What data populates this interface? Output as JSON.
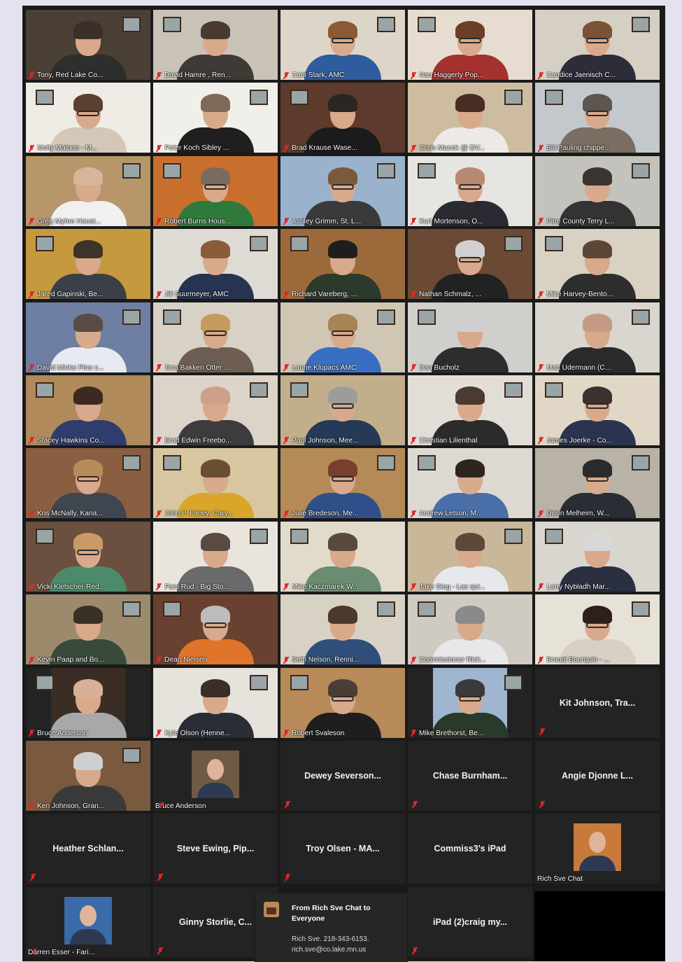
{
  "participants": [
    {
      "name": "Tony, Red Lake Co...",
      "muted": true,
      "video": true,
      "wall": "#4a4036",
      "hair": "#3a3029",
      "shirt": "#2e2e2e",
      "glasses": false
    },
    {
      "name": "David Hamre , Ren...",
      "muted": true,
      "video": true,
      "wall": "#c9c3b7",
      "hair": "#4a3a2e",
      "shirt": "#3e3a36",
      "glasses": false
    },
    {
      "name": "Carli Stark, AMC",
      "muted": true,
      "video": true,
      "wall": "#ddd6c8",
      "hair": "#8a5a34",
      "shirt": "#2f5c9e",
      "glasses": true
    },
    {
      "name": "Nan Haggerty Pop...",
      "muted": true,
      "video": true,
      "wall": "#e6ddd0",
      "hair": "#6b3e25",
      "shirt": "#a3312e",
      "glasses": true
    },
    {
      "name": "Candice Jaenisch C...",
      "muted": true,
      "video": true,
      "wall": "#d6cfc3",
      "hair": "#7a5236",
      "shirt": "#2d2d3a",
      "glasses": true
    },
    {
      "name": "Molly Malone - M...",
      "muted": true,
      "video": true,
      "wall": "#efece6",
      "hair": "#5b4030",
      "shirt": "#d2c7b8",
      "glasses": true
    },
    {
      "name": "Peter Koch Sibley ...",
      "muted": true,
      "video": true,
      "wall": "#f1efe9",
      "hair": "#7d6a58",
      "shirt": "#1f1f1f",
      "glasses": false
    },
    {
      "name": "Brad Krause Wase...",
      "muted": true,
      "video": true,
      "wall": "#5e3a2c",
      "hair": "#2c2622",
      "shirt": "#1b1b1b",
      "glasses": false
    },
    {
      "name": "Chris Macek @ DV...",
      "muted": true,
      "video": true,
      "wall": "#cdbca0",
      "hair": "#4a2d22",
      "shirt": "#ece9e6",
      "glasses": false
    },
    {
      "name": "Bill Pauling chippe...",
      "muted": true,
      "video": true,
      "wall": "#c3c8cc",
      "hair": "#5c5550",
      "shirt": "#7a6d62",
      "glasses": true
    },
    {
      "name": "Greg Myhre  Houst...",
      "muted": true,
      "video": true,
      "wall": "#b79669",
      "hair": "#d8b49a",
      "shirt": "#f0f0f0",
      "glasses": false
    },
    {
      "name": "Robert Burns Hous...",
      "muted": true,
      "video": true,
      "wall": "#c86f2e",
      "hair": "#7a6b60",
      "shirt": "#2d7a3b",
      "glasses": true
    },
    {
      "name": "Ashley Grimm, St. L...",
      "muted": true,
      "video": true,
      "wall": "#9ab2cc",
      "hair": "#7a5a3c",
      "shirt": "#3a3a3a",
      "glasses": true
    },
    {
      "name": "Kurt Mortenson, O...",
      "muted": true,
      "video": true,
      "wall": "#e7e5e1",
      "hair": "#b88a72",
      "shirt": "#2a2a33",
      "glasses": true
    },
    {
      "name": "Pine County Terry L...",
      "muted": true,
      "video": true,
      "wall": "#c4c2bc",
      "hair": "#3a3530",
      "shirt": "#333333",
      "glasses": false
    },
    {
      "name": "Jared Gapinski, Be...",
      "muted": true,
      "video": true,
      "wall": "#c59a3e",
      "hair": "#3e3329",
      "shirt": "#3b3f48",
      "glasses": false
    },
    {
      "name": "Jill Suurmeyer, AMC",
      "muted": true,
      "video": true,
      "wall": "#dedbd5",
      "hair": "#8a5c3a",
      "shirt": "#263352",
      "glasses": false
    },
    {
      "name": "Richard Vareberg, ...",
      "muted": true,
      "video": true,
      "wall": "#9c6a3a",
      "hair": "#1e1e1e",
      "shirt": "#2c3a2c",
      "glasses": false
    },
    {
      "name": "Nathan Schmalz, ...",
      "muted": true,
      "video": true,
      "wall": "#6a4a34",
      "hair": "#d0d0d0",
      "shirt": "#222222",
      "glasses": true
    },
    {
      "name": "Mike Harvey-Bento...",
      "muted": true,
      "video": true,
      "wall": "#d9d2c2",
      "hair": "#5c4636",
      "shirt": "#2e2e2e",
      "glasses": false
    },
    {
      "name": "David Minke Pine c...",
      "muted": true,
      "video": true,
      "wall": "#6e7fa3",
      "hair": "#5a4c44",
      "shirt": "#e7ebf1",
      "glasses": false
    },
    {
      "name": "Tara Bakken  Otter ...",
      "muted": true,
      "video": true,
      "wall": "#d8d2c6",
      "hair": "#c49a5e",
      "shirt": "#6e5e52",
      "glasses": true
    },
    {
      "name": "Laurie Klupacs  AMC",
      "muted": true,
      "video": true,
      "wall": "#cfc7b4",
      "hair": "#a88454",
      "shirt": "#3a6ec2",
      "glasses": true
    },
    {
      "name": "Dan   Bucholz",
      "muted": true,
      "video": true,
      "wall": "#cfd0cc",
      "hair": "#cfcfcf",
      "shirt": "#2d2d2d",
      "glasses": false
    },
    {
      "name": "Matt Udermann (C...",
      "muted": true,
      "video": true,
      "wall": "#d8d6cf",
      "hair": "#c49a84",
      "shirt": "#2a2a2a",
      "glasses": false
    },
    {
      "name": "Stacey Hawkins Co...",
      "muted": true,
      "video": true,
      "wall": "#b08a5a",
      "hair": "#3c2a22",
      "shirt": "#2f3c6e",
      "glasses": false
    },
    {
      "name": "Brad Edwin Freebo...",
      "muted": true,
      "video": true,
      "wall": "#dcd4c8",
      "hair": "#cfa088",
      "shirt": "#3c3c3c",
      "glasses": false
    },
    {
      "name": "Paul Johnson, Mee...",
      "muted": true,
      "video": true,
      "wall": "#c2ae8a",
      "hair": "#9c9c9c",
      "shirt": "#263a58",
      "glasses": true
    },
    {
      "name": "Christian Lilienthal",
      "muted": true,
      "video": true,
      "wall": "#e2ddd6",
      "hair": "#4a3a30",
      "shirt": "#2b2b2b",
      "glasses": false
    },
    {
      "name": "James Joerke - Co...",
      "muted": true,
      "video": true,
      "wall": "#e0d7c6",
      "hair": "#3a3230",
      "shirt": "#2a3450",
      "glasses": true
    },
    {
      "name": "Kris McNally, Kana...",
      "muted": true,
      "video": true,
      "wall": "#8a5e40",
      "hair": "#b88c5a",
      "shirt": "#3f4650",
      "glasses": true
    },
    {
      "name": "John P. Fahey, Cary...",
      "muted": true,
      "video": true,
      "wall": "#d8c6a0",
      "hair": "#6a4e34",
      "shirt": "#d9a62a",
      "glasses": false
    },
    {
      "name": "Julie Bredeson, Me...",
      "muted": true,
      "video": true,
      "wall": "#b48a56",
      "hair": "#7a3e2e",
      "shirt": "#2f4f8a",
      "glasses": true
    },
    {
      "name": "Andrew Letson, M...",
      "muted": true,
      "video": true,
      "wall": "#ddd9d2",
      "hair": "#2e2520",
      "shirt": "#4a6fa8",
      "glasses": false
    },
    {
      "name": "Dillon Melheim, W...",
      "muted": true,
      "video": true,
      "wall": "#b9b2a6",
      "hair": "#2a2a2a",
      "shirt": "#2a2d33",
      "glasses": true
    },
    {
      "name": "Vicki Kletscher-Red...",
      "muted": true,
      "video": true,
      "wall": "#6b5040",
      "hair": "#c99a66",
      "shirt": "#4c8a6c",
      "glasses": true
    },
    {
      "name": "Pam Rud - Big Sto...",
      "muted": true,
      "video": true,
      "wall": "#e9e5dc",
      "hair": "#5a4a40",
      "shirt": "#6a6a6a",
      "glasses": false
    },
    {
      "name": "Mike Kaczmarek W...",
      "muted": true,
      "video": true,
      "wall": "#e2dacb",
      "hair": "#5a4a3e",
      "shirt": "#6c8c72",
      "glasses": false
    },
    {
      "name": "Jake Sieg - Lac qui...",
      "muted": true,
      "video": true,
      "wall": "#c9b79a",
      "hair": "#5e4838",
      "shirt": "#e6e8ec",
      "glasses": false
    },
    {
      "name": "Larry Nybladh Mar...",
      "muted": true,
      "video": true,
      "wall": "#d9d6d0",
      "hair": "#d8d8d8",
      "shirt": "#2a3040",
      "glasses": false
    },
    {
      "name": "Kevin Paap and Bo...",
      "muted": true,
      "video": true,
      "wall": "#9c8a6c",
      "hair": "#3a3024",
      "shirt": "#3a4a3a",
      "glasses": false
    },
    {
      "name": "Dean Nielsen",
      "muted": true,
      "video": true,
      "wall": "#6a4030",
      "hair": "#bdbdbd",
      "shirt": "#e0742a",
      "glasses": true
    },
    {
      "name": "Seth Nelson, Renni...",
      "muted": true,
      "video": true,
      "wall": "#d8d2c4",
      "hair": "#4a3a2c",
      "shirt": "#2f4f7a",
      "glasses": false
    },
    {
      "name": "Commissioner Rick...",
      "muted": true,
      "video": true,
      "wall": "#cfcac2",
      "hair": "#8a8a8a",
      "shirt": "#e8e8e8",
      "glasses": false
    },
    {
      "name": "Brandi Bourquin - ...",
      "muted": true,
      "video": true,
      "wall": "#e6e2d8",
      "hair": "#2e1f1a",
      "shirt": "#d8d0c4",
      "glasses": true
    },
    {
      "name": "Bruce Anderson",
      "muted": true,
      "video": true,
      "wall": "#3a2e24",
      "hair": "#d8b098",
      "shirt": "#a8a8a8",
      "glasses": false,
      "inset": true
    },
    {
      "name": "Kyle Olson (Henne...",
      "muted": true,
      "video": true,
      "wall": "#e6e2dc",
      "hair": "#3a2e26",
      "shirt": "#2a2d35",
      "glasses": false
    },
    {
      "name": "Robert Svaleson",
      "muted": true,
      "video": true,
      "wall": "#b88a5a",
      "hair": "#4a3e34",
      "shirt": "#1e1e1e",
      "glasses": true
    },
    {
      "name": "Mike Brethorst, Be...",
      "muted": true,
      "video": true,
      "wall": "#9fb5d0",
      "hair": "#3a3a3a",
      "shirt": "#2a3a2a",
      "glasses": true,
      "inset": true
    },
    {
      "name": "Kit Johnson, Tra...",
      "muted": true,
      "video": false
    },
    {
      "name": "Ken Johnson, Gran...",
      "muted": true,
      "video": true,
      "wall": "#7a5a3e",
      "hair": "#cfcfcf",
      "shirt": "#3a3a3a",
      "glasses": false
    },
    {
      "name": "Bruce Anderson",
      "muted": true,
      "video": false,
      "photo": true
    },
    {
      "name": "Dewey  Severson...",
      "muted": true,
      "video": false
    },
    {
      "name": "Chase  Burnham...",
      "muted": true,
      "video": false
    },
    {
      "name": "Angie  Djonne  L...",
      "muted": true,
      "video": false
    },
    {
      "name": "Heather  Schlan...",
      "muted": true,
      "video": false
    },
    {
      "name": "Steve  Ewing,  Pip...",
      "muted": true,
      "video": false
    },
    {
      "name": "Troy  Olsen  -  MA...",
      "muted": true,
      "video": false
    },
    {
      "name": "Commiss3's  iPad",
      "muted": false,
      "video": false
    },
    {
      "name": "Rich Sve Chat",
      "muted": false,
      "video": false,
      "photo": true,
      "photoColor": "#c97a3a"
    },
    {
      "name": "Darren Esser - Fari...",
      "muted": true,
      "video": false,
      "photo": true,
      "photoColor": "#3a6aa8"
    },
    {
      "name": "Ginny  Storlie,  C...",
      "muted": true,
      "video": false
    },
    {
      "name": "",
      "muted": false,
      "video": false,
      "hidden": true
    },
    {
      "name": "iPad  (2)craig  my...",
      "muted": true,
      "video": false
    }
  ],
  "chat": {
    "title": "From Rich Sve Chat to Everyone",
    "message": "Rich Sve. 218-343-6153. rich.sve@co.lake.mn.us"
  }
}
